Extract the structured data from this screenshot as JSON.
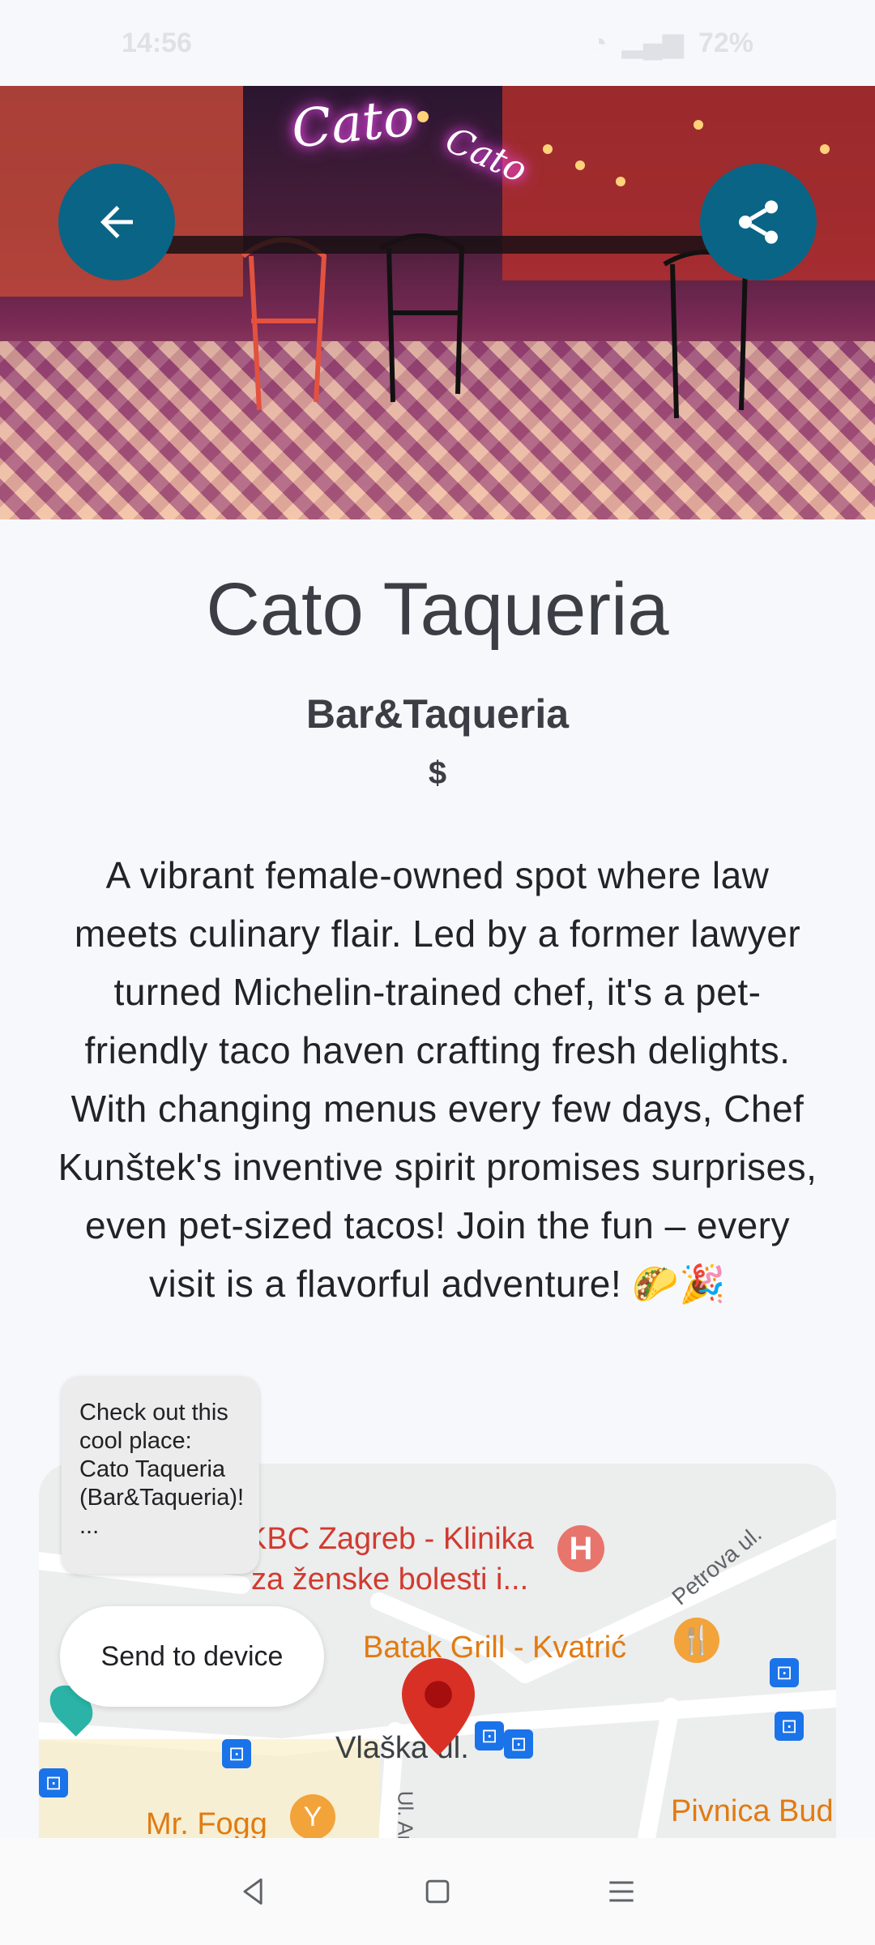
{
  "status_bar": {
    "time": "14:56",
    "battery": "72%"
  },
  "hero": {
    "image": "restaurant-interior-photo",
    "neon_sign_main": "Cato",
    "neon_sign_small": "Cato",
    "back_button_icon": "arrow-left-icon",
    "share_button_icon": "share-icon"
  },
  "place": {
    "name": "Cato Taqueria",
    "category": "Bar&Taqueria",
    "price": "$",
    "description": "A vibrant female-owned spot where law meets culinary flair. Led by a former lawyer turned Michelin-trained chef, it's a pet-friendly taco haven crafting fresh delights. With changing menus every few days, Chef Kunštek's inventive spirit promises surprises, even pet-sized tacos! Join the fun – every visit is a flavorful adventure! 🌮🎉"
  },
  "map": {
    "labels": {
      "hospital": "KBC Zagreb - Klinika",
      "hospital_line2": "za ženske bolesti i...",
      "restaurant": "Batak Grill - Kvatrić",
      "street_petrova": "Petrova ul.",
      "street_vlaska": "Vlaška ul.",
      "bar": "Mr. Fogg",
      "pub": "Pivnica Bud",
      "street_vertical": "Ul. Ar"
    }
  },
  "share_tooltip": {
    "text": "Check out this cool place: Cato Taqueria (Bar&Taqueria)! ..."
  },
  "send_button": {
    "label": "Send to device"
  },
  "colors": {
    "accent": "#0a6485",
    "background": "#f7f8fc",
    "map_pin": "#d93025"
  }
}
